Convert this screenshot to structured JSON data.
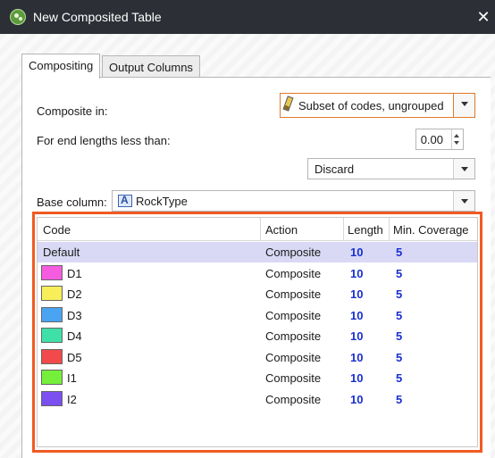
{
  "window": {
    "title": "New Composited Table",
    "close_glyph": "✕"
  },
  "tabs": [
    {
      "label": "Compositing",
      "active": true
    },
    {
      "label": "Output Columns",
      "active": false
    }
  ],
  "form": {
    "composite_in_label": "Composite in:",
    "composite_in_value": "Subset of codes, ungrouped",
    "end_lengths_label": "For end lengths less than:",
    "end_lengths_value": "0.00",
    "end_action_value": "Discard",
    "base_column_label": "Base column:",
    "base_column_value": "RockType"
  },
  "table": {
    "headers": [
      "Code",
      "Action",
      "Length",
      "Min. Coverage"
    ],
    "rows": [
      {
        "code": "Default",
        "color": null,
        "action": "Composite",
        "length": "10",
        "min_coverage": "5",
        "selected": true
      },
      {
        "code": "D1",
        "color": "#f55ce0",
        "action": "Composite",
        "length": "10",
        "min_coverage": "5"
      },
      {
        "code": "D2",
        "color": "#f7ee5a",
        "action": "Composite",
        "length": "10",
        "min_coverage": "5"
      },
      {
        "code": "D3",
        "color": "#4aa4f2",
        "action": "Composite",
        "length": "10",
        "min_coverage": "5"
      },
      {
        "code": "D4",
        "color": "#3fe0a8",
        "action": "Composite",
        "length": "10",
        "min_coverage": "5"
      },
      {
        "code": "D5",
        "color": "#f24a4a",
        "action": "Composite",
        "length": "10",
        "min_coverage": "5"
      },
      {
        "code": "I1",
        "color": "#74f03a",
        "action": "Composite",
        "length": "10",
        "min_coverage": "5"
      },
      {
        "code": "I2",
        "color": "#7b4ff0",
        "action": "Composite",
        "length": "10",
        "min_coverage": "5"
      }
    ]
  },
  "colors": {
    "highlight": "#f05a22",
    "title_bar": "#2c2f36",
    "value_blue": "#1a2fd0",
    "selected_row": "#d9d9f5"
  }
}
